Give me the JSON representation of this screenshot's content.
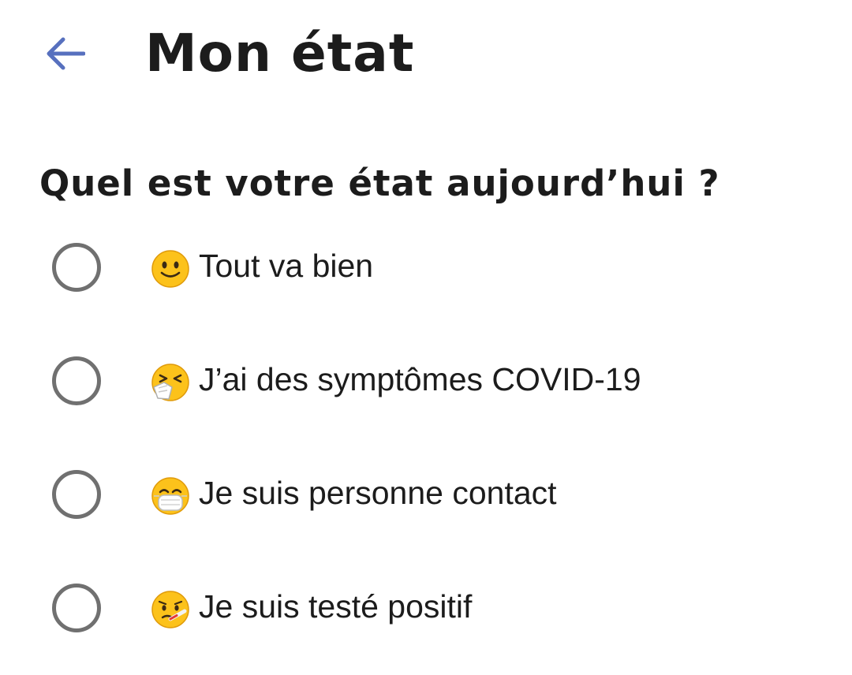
{
  "header": {
    "title": "Mon état",
    "back_icon": "arrow-left-icon",
    "accent_color": "#5770be"
  },
  "question": "Quel est votre état aujourd’hui ?",
  "options": [
    {
      "emoji_icon": "slightly-smiling-face-icon",
      "label": "Tout va bien",
      "selected": false
    },
    {
      "emoji_icon": "sneezing-face-icon",
      "label": "J’ai des symptômes COVID-19",
      "selected": false
    },
    {
      "emoji_icon": "face-with-medical-mask-icon",
      "label": "Je suis personne contact",
      "selected": false
    },
    {
      "emoji_icon": "face-with-thermometer-icon",
      "label": "Je suis testé positif",
      "selected": false
    }
  ]
}
